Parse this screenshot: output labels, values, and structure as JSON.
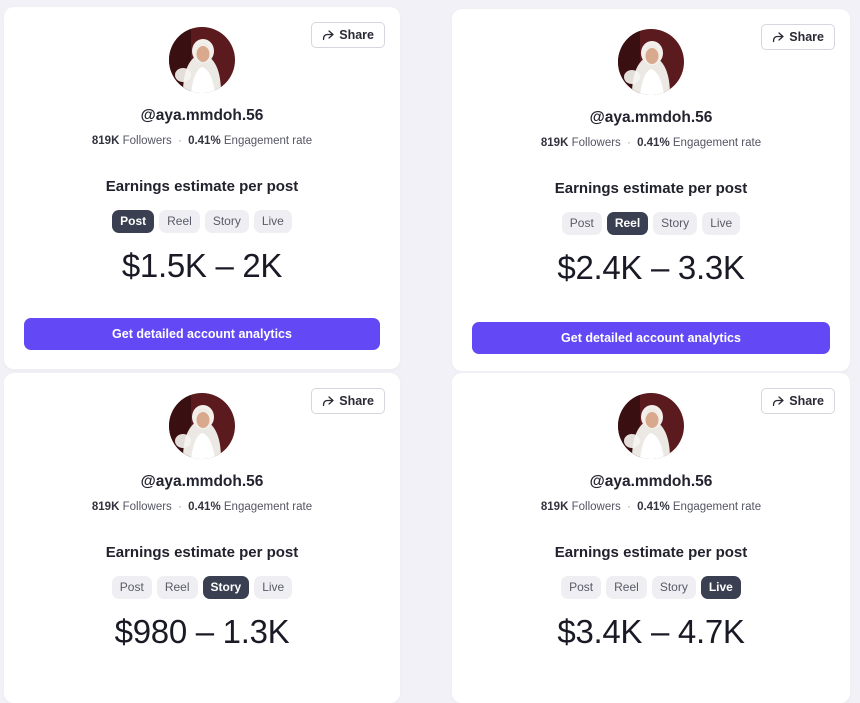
{
  "cards": [
    {
      "share_label": "Share",
      "username": "@aya.mmdoh.56",
      "followers_value": "819K",
      "followers_label": "Followers",
      "separator": "·",
      "engagement_value": "0.41%",
      "engagement_label": "Engagement rate",
      "earnings_title": "Earnings estimate per post",
      "tabs": [
        "Post",
        "Reel",
        "Story",
        "Live"
      ],
      "active_tab": "Post",
      "range": "$1.5K – 2K",
      "cta_label": "Get detailed account analytics"
    },
    {
      "share_label": "Share",
      "username": "@aya.mmdoh.56",
      "followers_value": "819K",
      "followers_label": "Followers",
      "separator": "·",
      "engagement_value": "0.41%",
      "engagement_label": "Engagement rate",
      "earnings_title": "Earnings estimate per post",
      "tabs": [
        "Post",
        "Reel",
        "Story",
        "Live"
      ],
      "active_tab": "Reel",
      "range": "$2.4K – 3.3K",
      "cta_label": "Get detailed account analytics"
    },
    {
      "share_label": "Share",
      "username": "@aya.mmdoh.56",
      "followers_value": "819K",
      "followers_label": "Followers",
      "separator": "·",
      "engagement_value": "0.41%",
      "engagement_label": "Engagement rate",
      "earnings_title": "Earnings estimate per post",
      "tabs": [
        "Post",
        "Reel",
        "Story",
        "Live"
      ],
      "active_tab": "Story",
      "range": "$980 – 1.3K",
      "cta_label": ""
    },
    {
      "share_label": "Share",
      "username": "@aya.mmdoh.56",
      "followers_value": "819K",
      "followers_label": "Followers",
      "separator": "·",
      "engagement_value": "0.41%",
      "engagement_label": "Engagement rate",
      "earnings_title": "Earnings estimate per post",
      "tabs": [
        "Post",
        "Reel",
        "Story",
        "Live"
      ],
      "active_tab": "Live",
      "range": "$3.4K – 4.7K",
      "cta_label": ""
    }
  ],
  "colors": {
    "accent": "#6348f5",
    "active_tab_bg": "#3a3f51",
    "tab_bg": "#efeff3",
    "page_bg": "#f1f1f7"
  },
  "icons": {
    "share": "share-arrow-icon",
    "avatar": "profile-photo"
  }
}
